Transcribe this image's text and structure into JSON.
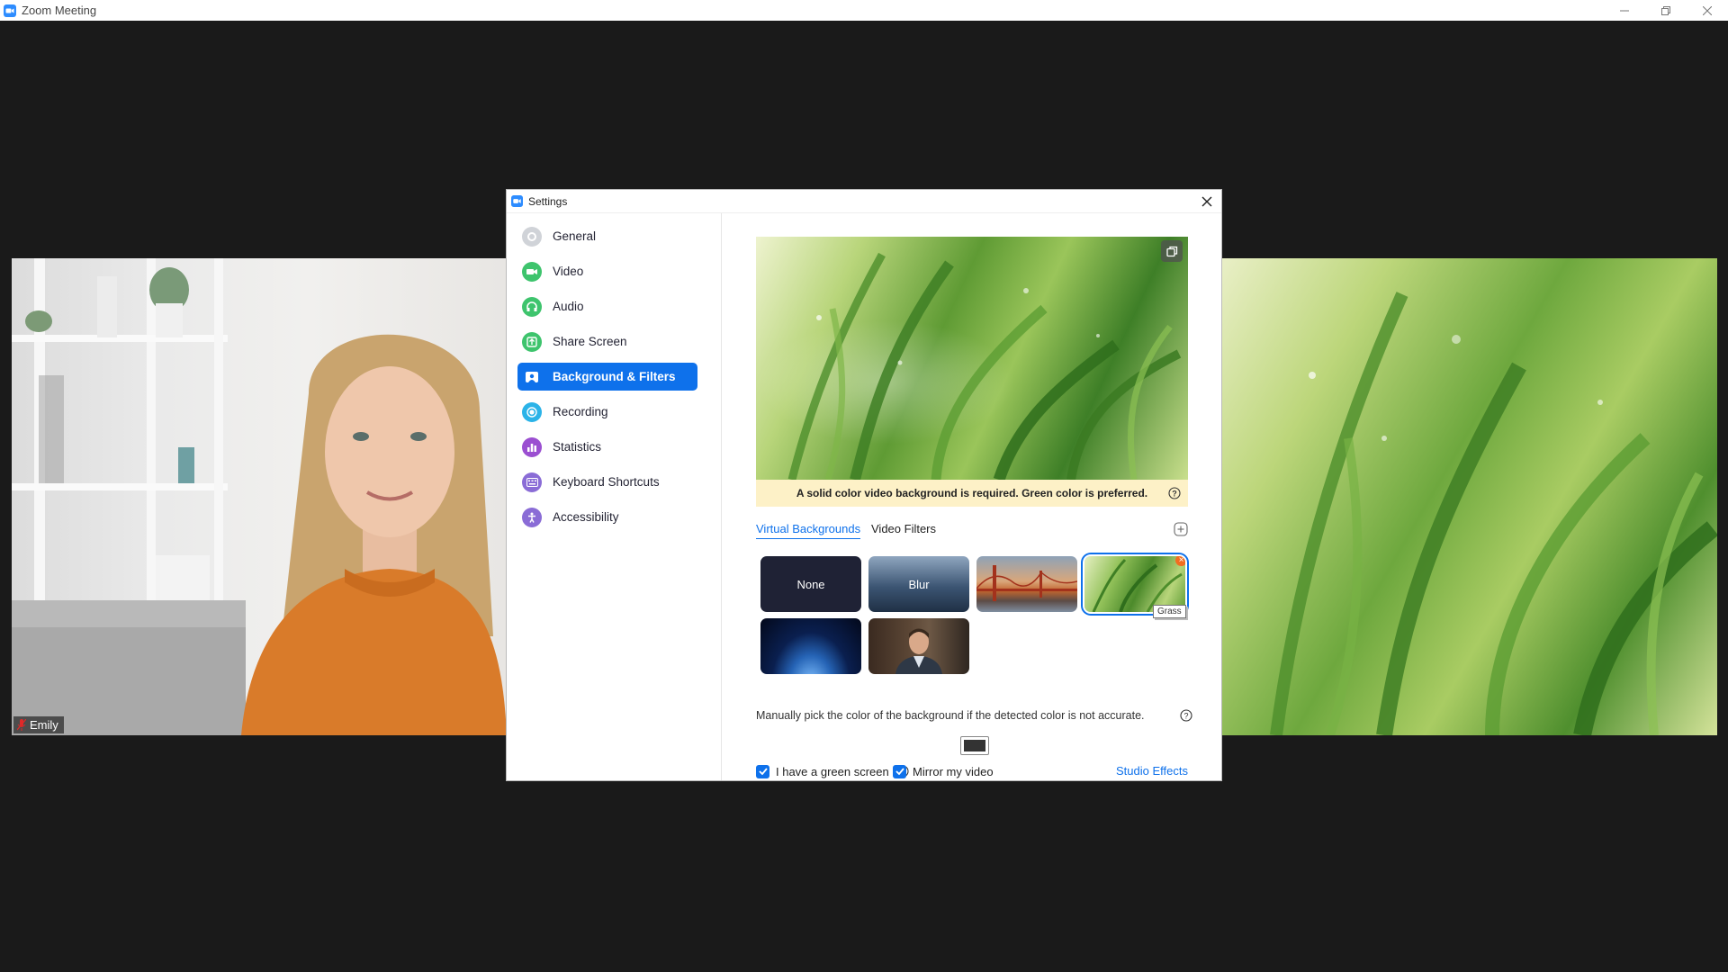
{
  "window": {
    "title": "Zoom Meeting",
    "controls": {
      "minimize": "minimize-icon",
      "restore": "restore-icon",
      "close": "close-icon"
    }
  },
  "participants": [
    {
      "name": "Emily",
      "muted": true
    }
  ],
  "settings_dialog": {
    "title": "Settings",
    "sidebar": {
      "items": [
        {
          "label": "General",
          "icon": "gear-icon",
          "color": "#d0d3d8"
        },
        {
          "label": "Video",
          "icon": "video-camera-icon",
          "color": "#3ec46d"
        },
        {
          "label": "Audio",
          "icon": "headphones-icon",
          "color": "#3ec46d"
        },
        {
          "label": "Share Screen",
          "icon": "share-screen-icon",
          "color": "#3ec46d"
        },
        {
          "label": "Background & Filters",
          "icon": "background-icon",
          "color": "#0e71eb",
          "active": true
        },
        {
          "label": "Recording",
          "icon": "record-icon",
          "color": "#2bb3e8"
        },
        {
          "label": "Statistics",
          "icon": "bar-chart-icon",
          "color": "#9b4fd1"
        },
        {
          "label": "Keyboard Shortcuts",
          "icon": "keyboard-icon",
          "color": "#8a6cd6"
        },
        {
          "label": "Accessibility",
          "icon": "accessibility-icon",
          "color": "#8a6cd6"
        }
      ]
    },
    "warning": "A solid color video background is required. Green color is preferred.",
    "tabs": [
      {
        "label": "Virtual Backgrounds",
        "active": true
      },
      {
        "label": "Video Filters",
        "active": false
      }
    ],
    "backgrounds": [
      {
        "label": "None",
        "kind": "none"
      },
      {
        "label": "Blur",
        "kind": "blur"
      },
      {
        "label": "",
        "kind": "bridge"
      },
      {
        "label": "",
        "kind": "grass",
        "selected": true
      },
      {
        "label": "",
        "kind": "space"
      },
      {
        "label": "",
        "kind": "person"
      }
    ],
    "tooltip": "Grass",
    "manual_pick_text": "Manually pick the color of the background if the detected color is not accurate.",
    "checkboxes": {
      "green_screen": {
        "label": "I have a green screen",
        "checked": true
      },
      "mirror": {
        "label": "Mirror my video",
        "checked": true
      }
    },
    "studio_effects": "Studio Effects"
  },
  "colors": {
    "accent": "#0e71eb",
    "warning_bg": "#fdf1c7",
    "muted_red": "#e02828"
  }
}
